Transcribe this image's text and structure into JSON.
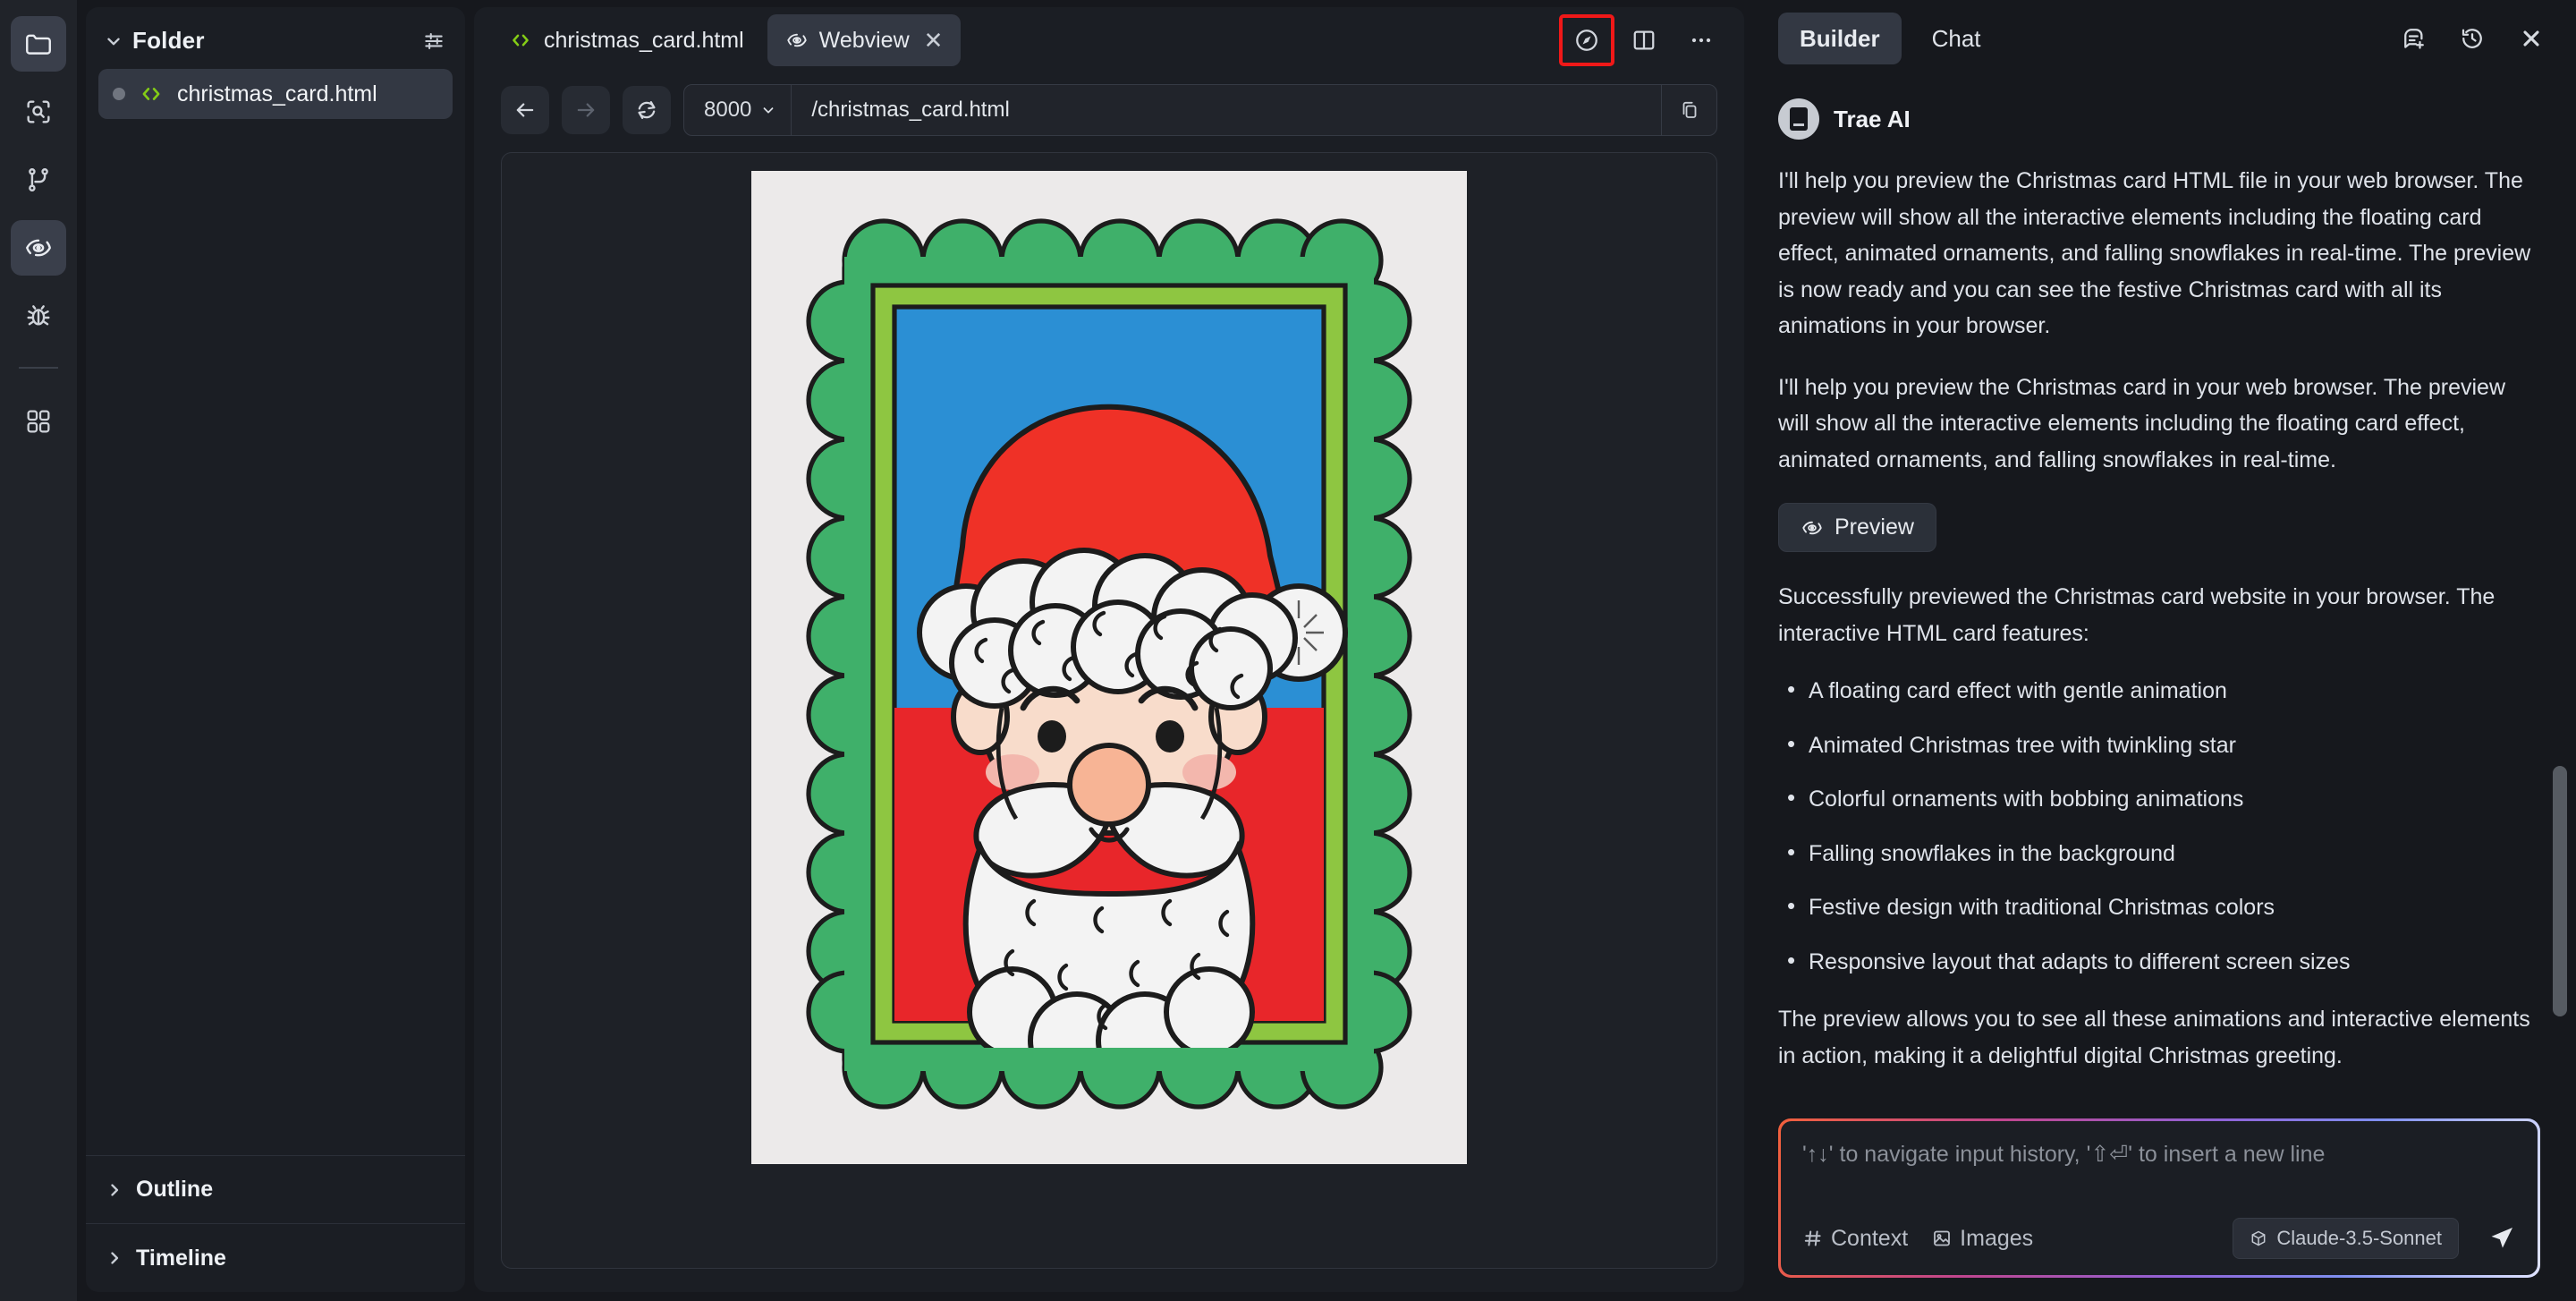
{
  "activity_bar": {
    "items": [
      {
        "name": "explorer",
        "icon": "folder-icon",
        "active": true
      },
      {
        "name": "search",
        "icon": "search-scan-icon",
        "active": false
      },
      {
        "name": "source-control",
        "icon": "git-branch-icon",
        "active": false
      },
      {
        "name": "webview-preview",
        "icon": "eye-icon",
        "active": true
      },
      {
        "name": "run-and-debug",
        "icon": "bug-icon",
        "active": false
      },
      {
        "name": "extensions",
        "icon": "grid-icon",
        "active": false
      }
    ]
  },
  "explorer": {
    "title": "Folder",
    "filter_icon": "sliders-icon",
    "collapse_icon": "chevron-down-icon",
    "files": [
      {
        "name": "christmas_card.html",
        "icon": "code-icon",
        "modified": true
      }
    ],
    "sections": [
      {
        "label": "Outline",
        "icon": "chevron-right-icon"
      },
      {
        "label": "Timeline",
        "icon": "chevron-right-icon"
      }
    ]
  },
  "editor": {
    "tabs": [
      {
        "label": "christmas_card.html",
        "icon": "code-icon",
        "active": false,
        "closable": false
      },
      {
        "label": "Webview",
        "icon": "eye-icon",
        "active": true,
        "closable": true,
        "close_glyph": "✕"
      }
    ],
    "actions": [
      {
        "name": "open-in-browser",
        "icon": "compass-icon",
        "highlighted": true
      },
      {
        "name": "split-editor",
        "icon": "split-panel-icon",
        "highlighted": false
      },
      {
        "name": "more-actions",
        "icon": "ellipsis-icon",
        "highlighted": false
      }
    ]
  },
  "webview_toolbar": {
    "back_label": "←",
    "forward_label": "→",
    "reload_label": "⟳",
    "port": "8000",
    "port_caret": "⌄",
    "url": "/christmas_card.html",
    "copy_icon": "copy-icon"
  },
  "webview_content": {
    "image_description": "Hand-colored Santa Claus drawing in a scalloped green frame",
    "colors": {
      "paper": "#eceaea",
      "frame_green": "#3fb06a",
      "frame_lime": "#8ec641",
      "background_blue": "#2b8fd4",
      "background_red": "#e8262a",
      "hat_red": "#ef3127",
      "beard_white": "#f1f1f1",
      "skin": "#f6d6c2",
      "cheek": "#f3b7ad",
      "outline": "#1a1a1a"
    },
    "top_tab_color": "#3fb06a"
  },
  "chat_panel": {
    "tabs": [
      {
        "label": "Builder",
        "active": true
      },
      {
        "label": "Chat",
        "active": false
      }
    ],
    "header_actions": [
      {
        "name": "new-chat",
        "icon": "new-message-icon"
      },
      {
        "name": "history",
        "icon": "history-clock-icon"
      },
      {
        "name": "close-panel",
        "icon": "close-icon",
        "glyph": "✕"
      }
    ],
    "agent": {
      "name": "Trae AI",
      "avatar_icon": "trae-logo-icon"
    },
    "messages": [
      "I'll help you preview the Christmas card HTML file in your web browser. The preview will show all the interactive elements including the floating card effect, animated ornaments, and falling snowflakes in real-time. The preview is now ready and you can see the festive Christmas card with all its animations in your browser.",
      "I'll help you preview the Christmas card in your web browser. The preview will show all the interactive elements including the floating card effect, animated ornaments, and falling snowflakes in real-time."
    ],
    "preview_button": {
      "label": "Preview",
      "icon": "eye-icon"
    },
    "summary_text": "Successfully previewed the Christmas card website in your browser. The interactive HTML card features:",
    "features": [
      "A floating card effect with gentle animation",
      "Animated Christmas tree with twinkling star",
      "Colorful ornaments with bobbing animations",
      "Falling snowflakes in the background",
      "Festive design with traditional Christmas colors",
      "Responsive layout that adapts to different screen sizes"
    ],
    "closing_text": "The preview allows you to see all these animations and interactive elements in action, making it a delightful digital Christmas greeting."
  },
  "composer": {
    "placeholder": "'↑↓' to navigate input history, '⇧⏎' to insert a new line",
    "value": "",
    "context_label": "Context",
    "context_icon": "hash-icon",
    "images_label": "Images",
    "images_icon": "image-icon",
    "model": "Claude-3.5-Sonnet",
    "model_icon": "cube-icon",
    "send_icon": "send-icon",
    "border_gradient": [
      "#f2603c",
      "#c0468f",
      "#8f63d8",
      "#7f8ff0",
      "#dfe3ff"
    ]
  },
  "theme": {
    "bg": "#16181d",
    "panel": "#1b1e24",
    "panel_alt": "#202329",
    "selection": "#333843",
    "accent_green": "#84cc16",
    "highlight_red": "#f01818",
    "text": "#e7eaef",
    "text_dim": "#8b9099"
  }
}
